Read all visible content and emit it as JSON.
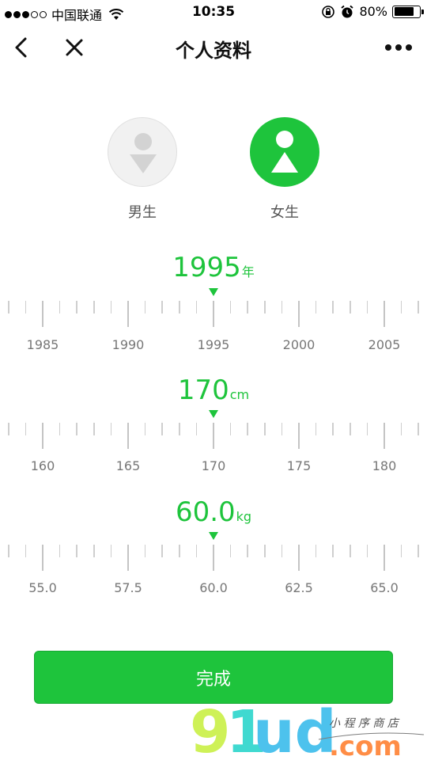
{
  "status_bar": {
    "carrier": "中国联通",
    "time": "10:35",
    "battery": "80%",
    "battery_level": 0.8,
    "signal_bars_filled": 3,
    "signal_bars_total": 5
  },
  "nav": {
    "title": "个人资料"
  },
  "gender": {
    "male_label": "男生",
    "female_label": "女生",
    "selected": "female"
  },
  "birth_year": {
    "value": "1995",
    "unit": "年",
    "ticks": [
      "1985",
      "1990",
      "1995",
      "2000",
      "2005"
    ]
  },
  "height": {
    "value": "170",
    "unit": "cm",
    "ticks": [
      "160",
      "165",
      "170",
      "175",
      "180"
    ]
  },
  "weight": {
    "value": "60.0",
    "unit": "kg",
    "ticks": [
      "55.0",
      "57.5",
      "60.0",
      "62.5",
      "65.0"
    ]
  },
  "done_label": "完成",
  "colors": {
    "accent": "#1ec43c",
    "tick": "#cfcfcf",
    "label": "#777777"
  }
}
